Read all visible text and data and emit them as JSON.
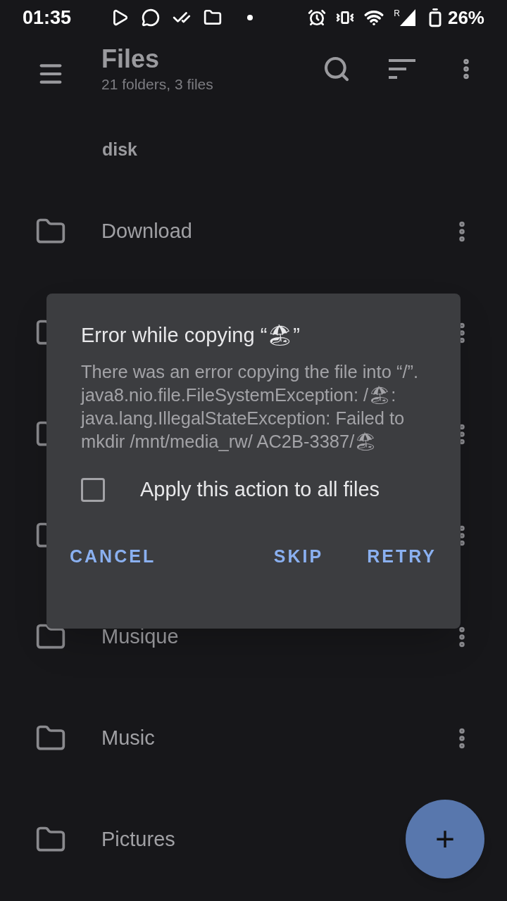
{
  "status_bar": {
    "time": "01:35",
    "battery": "26%",
    "roaming": "R"
  },
  "toolbar": {
    "title": "Files",
    "subtitle": "21 folders, 3 files"
  },
  "section": "disk",
  "rows": [
    {
      "label": "Download",
      "menu": true
    },
    {
      "menu": true
    },
    {
      "menu": true
    },
    {
      "menu": true
    },
    {
      "label": "Musique",
      "menu": true
    },
    {
      "label": "Music",
      "menu": true
    },
    {
      "label": "Pictures",
      "menu": false
    }
  ],
  "dialog": {
    "title": "Error while copying “🏖”",
    "message": "There was an error copying the file into “/”. java8.nio.file.FileSystemException: /🏖: java.lang.IllegalStateException: Failed to mkdir /mnt/media_rw/ AC2B-3387/🏖",
    "checkbox": {
      "label": "Apply this action to all files",
      "checked": false
    },
    "buttons": [
      "CANCEL",
      "SKIP",
      "RETRY"
    ]
  },
  "fab": "+"
}
